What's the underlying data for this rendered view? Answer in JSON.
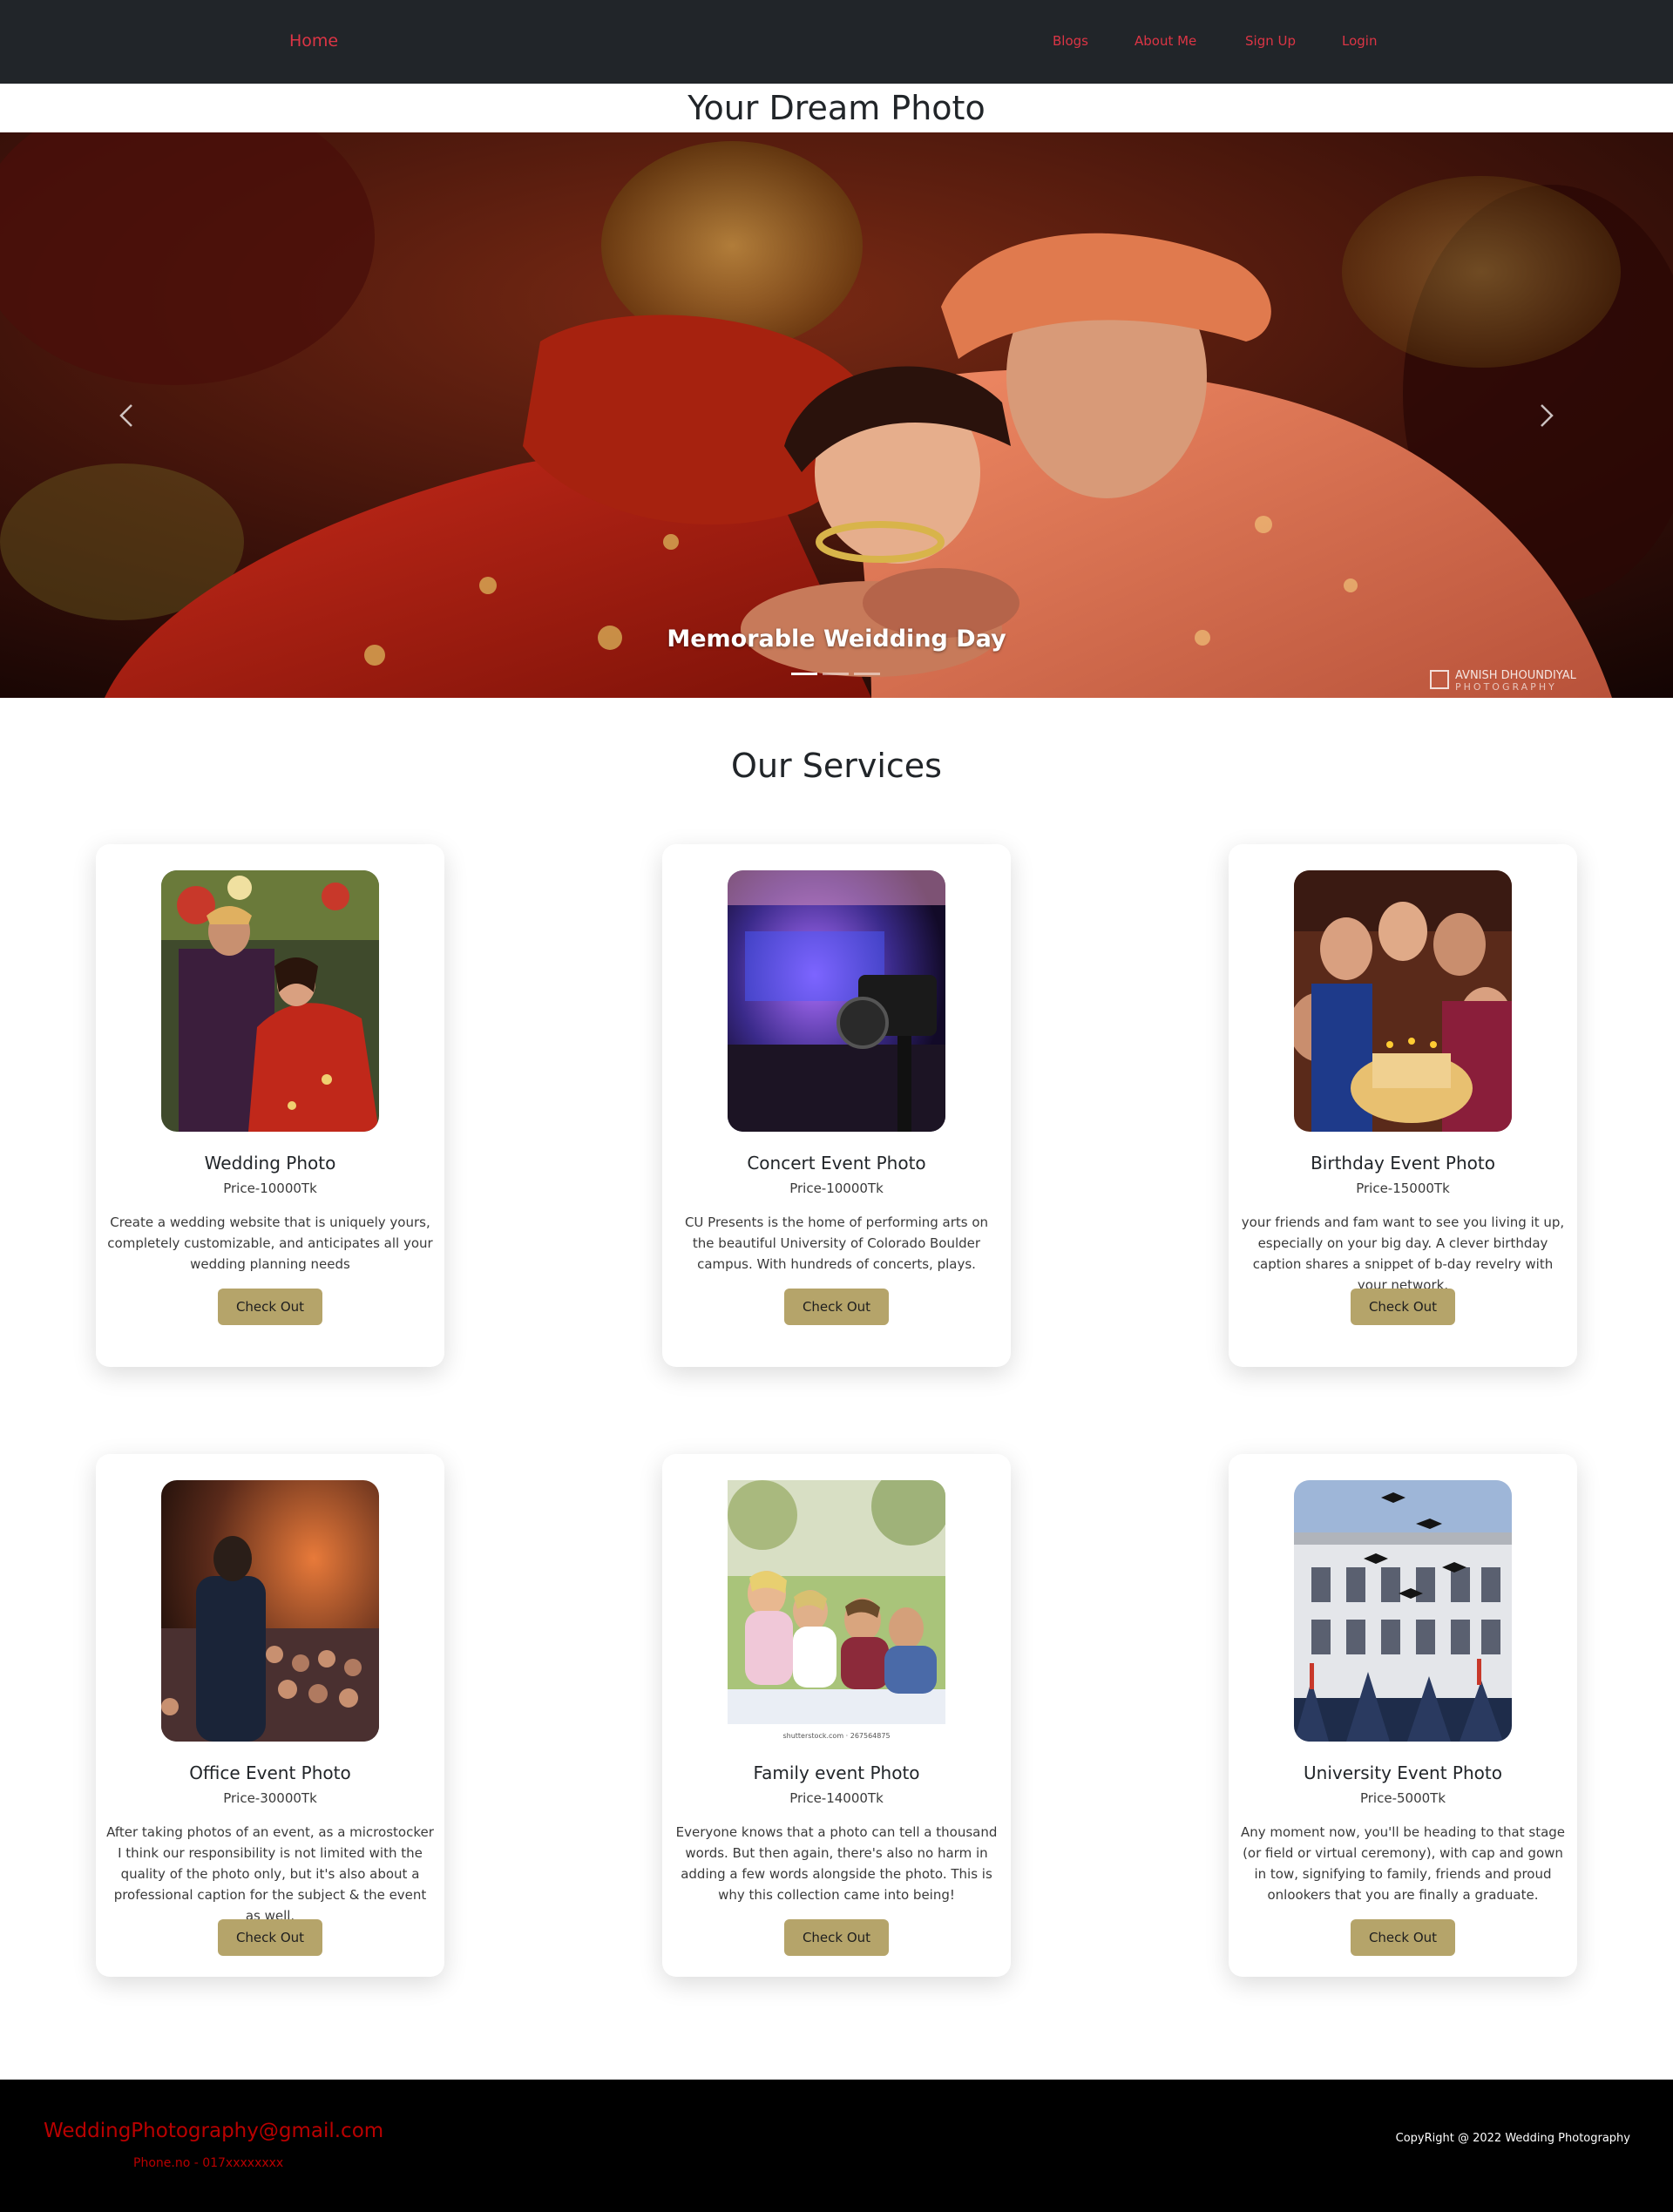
{
  "nav": {
    "home": "Home",
    "links": [
      "Blogs",
      "About Me",
      "Sign Up",
      "Login"
    ]
  },
  "site_title": "Your Dream Photo",
  "carousel": {
    "caption": "Memorable Weidding Day",
    "indicator_count": 3,
    "active_index": 0,
    "watermark": "AVNISH DHOUNDIYAL PHOTOGRAPHY",
    "prev_icon": "chevron-left-icon",
    "next_icon": "chevron-right-icon"
  },
  "services": {
    "title": "Our Services",
    "button_label": "Check Out",
    "cards": [
      {
        "title": "Wedding Photo",
        "price": "Price-10000Tk",
        "text": "Create a wedding website that is uniquely yours, completely customizable, and anticipates all your wedding planning needs"
      },
      {
        "title": "Concert Event Photo",
        "price": "Price-10000Tk",
        "text": "CU Presents is the home of performing arts on the beautiful University of Colorado Boulder campus. With hundreds of concerts, plays."
      },
      {
        "title": "Birthday Event Photo",
        "price": "Price-15000Tk",
        "text": "your friends and fam want to see you living it up, especially on your big day. A clever birthday caption shares a snippet of b-day revelry with your network."
      },
      {
        "title": "Office Event Photo",
        "price": "Price-30000Tk",
        "text": "After taking photos of an event, as a microstocker I think our responsibility is not limited with the quality of the photo only, but it's also about a professional caption for the subject & the event as well."
      },
      {
        "title": "Family event Photo",
        "price": "Price-14000Tk",
        "text": "Everyone knows that a photo can tell a thousand words. But then again, there's also no harm in adding a few words alongside the photo. This is why this collection came into being!"
      },
      {
        "title": "University Event Photo",
        "price": "Price-5000Tk",
        "text": "Any moment now, you'll be heading to that stage (or field or virtual ceremony), with cap and gown in tow, signifying to family, friends and proud onlookers that you are finally a graduate."
      }
    ],
    "family_stock_credit": "shutterstock.com · 267564875"
  },
  "footer": {
    "email": "WeddingPhotography@gmail.com",
    "phone": "Phone.no - 017xxxxxxxx",
    "copyright": "CopyRight @ 2022 Wedding Photography"
  }
}
